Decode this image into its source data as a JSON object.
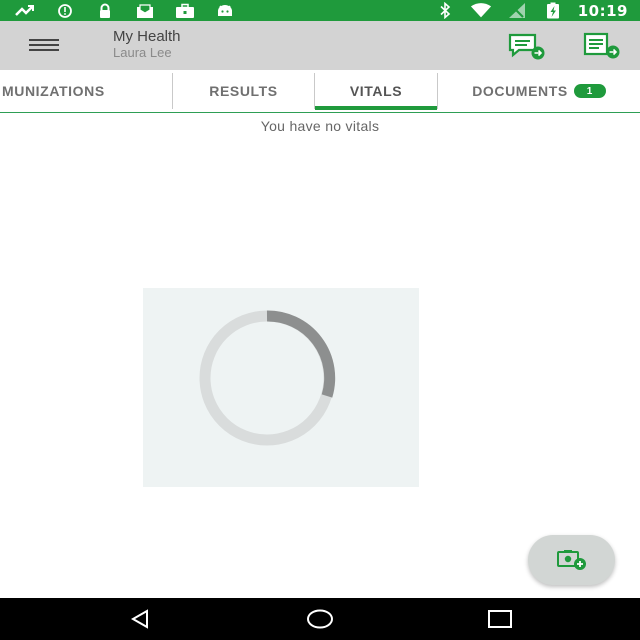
{
  "status_bar": {
    "time": "10:19",
    "left_icons": [
      "missed-call-icon",
      "alert-circle-icon",
      "lock-icon",
      "mail-tray-icon",
      "briefcase-icon",
      "android-icon"
    ],
    "right_icons": [
      "bluetooth-icon",
      "wifi-icon",
      "signal-icon",
      "battery-charging-icon"
    ],
    "color": "#1f9a3c"
  },
  "app_bar": {
    "title": "My Health",
    "subtitle": "Laura Lee",
    "menu_icon": "hamburger-menu-icon",
    "actions": [
      "message-send-icon",
      "document-send-icon"
    ]
  },
  "tabs": [
    {
      "label": "MUNIZATIONS",
      "active": false
    },
    {
      "label": "RESULTS",
      "active": false
    },
    {
      "label": "VITALS",
      "active": true
    },
    {
      "label": "DOCUMENTS",
      "active": false,
      "badge": "1"
    }
  ],
  "content": {
    "empty_message": "You have no vitals",
    "loading": true
  },
  "fab": {
    "icon": "add-photo-icon"
  },
  "nav_bar": {
    "buttons": [
      "back-icon",
      "home-icon",
      "recents-icon"
    ]
  },
  "colors": {
    "accent": "#1f9a3c",
    "app_bar": "#d3d3d3",
    "tab_text": "#707070"
  }
}
